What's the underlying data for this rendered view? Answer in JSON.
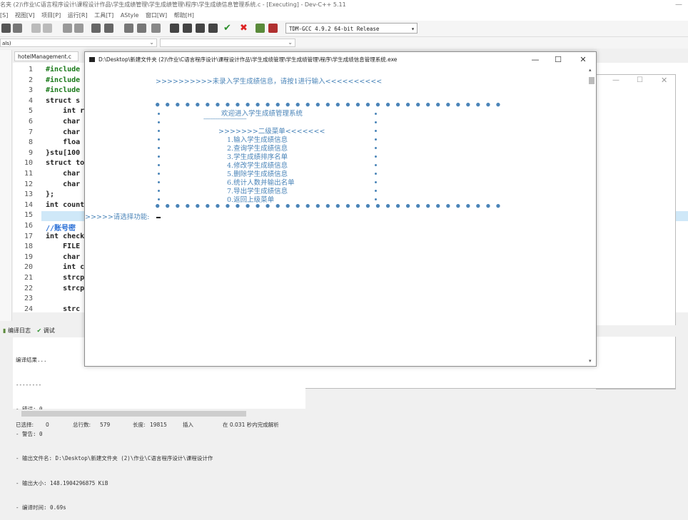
{
  "ide": {
    "title": "名夹 (2)\\作业\\C语言程序设计\\课程设计作品\\学生成绩管理\\学生成绩管理\\程序\\学生成绩信息管理系统.c - [Executing] - Dev-C++ 5.11",
    "menu": [
      "[S]",
      "视图[V]",
      "项目[P]",
      "运行[R]",
      "工具[T]",
      "AStyle",
      "窗口[W]",
      "帮助[H]"
    ],
    "compiler": "TDM-GCC 4.9.2 64-bit Release",
    "combo_left": "als)",
    "file_tab": "hotelManagement.c"
  },
  "editor": {
    "line_numbers": [
      "1",
      "2",
      "3",
      "4",
      "5",
      "6",
      "7",
      "8",
      "9",
      "10",
      "11",
      "12",
      "13",
      "14",
      "15",
      "16",
      "17",
      "18",
      "19",
      "20",
      "21",
      "22",
      "23",
      "24"
    ],
    "lines": [
      "#include",
      "#include",
      "#include",
      "struct s",
      "    int r",
      "    char",
      "    char",
      "    floa",
      "}stu[100",
      "struct to",
      "    char",
      "    char",
      "};",
      "int count",
      "",
      "//账号密",
      "int check",
      "    FILE",
      "    char",
      "    int c",
      "    strcp",
      "    strcp",
      "",
      "    strc"
    ]
  },
  "bottom": {
    "tabs": [
      "编译日志",
      "调试"
    ],
    "log": [
      "编译结果...",
      "--------",
      "- 错误: 0",
      "- 警告: 0",
      "- 输出文件名: D:\\Desktop\\新建文件夹 (2)\\作业\\C语言程序设计\\课程设计作",
      "- 输出大小: 148.1904296875 KiB",
      "- 编译时间: 0.69s"
    ]
  },
  "status": {
    "selected_label": "已选择:",
    "selected": "0",
    "total_label": "总行数:",
    "total": "579",
    "length_label": "长度:",
    "length": "19815",
    "mode": "插入",
    "parse": "在 0.031 秒内完成解析"
  },
  "console": {
    "title": "D:\\Desktop\\新建文件夹 (2)\\作业\\C语言程序设计\\课程设计作品\\学生成绩管理\\学生成绩管理\\程序\\学生成绩信息管理系统.exe",
    "notice": ">>>>>>>>>>未录入学生成绩信息，请按1进行输入<<<<<<<<<<",
    "welcome": "欢迎进入学生成绩管理系统",
    "separator": "----------------------------------",
    "submenu": ">>>>>>>二级菜单<<<<<<<",
    "items": [
      "1.输入学生成绩信息",
      "2.查询学生成绩信息",
      "3.学生成绩排序名单",
      "4.修改学生成绩信息",
      "5.删除学生成绩信息",
      "6.统计人数并输出名单",
      "7.导出学生成绩信息",
      "0.返回上级菜单"
    ],
    "prompt": ">>>>>请选择功能:"
  },
  "colors": {
    "console_text": "#4a84b8",
    "highlight_line": "#cfe8f8"
  }
}
